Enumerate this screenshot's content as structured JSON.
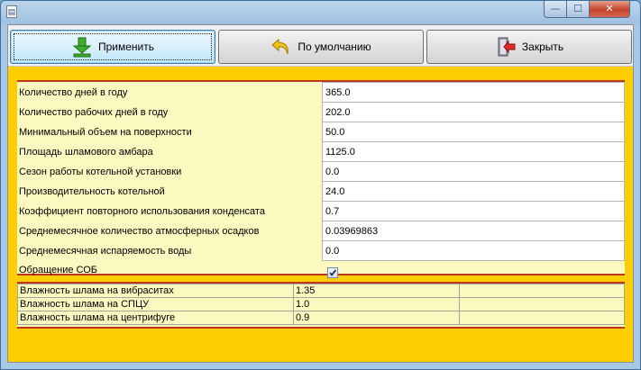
{
  "window": {
    "controls": {
      "minimize": "—",
      "maximize": "☐",
      "close": "✕"
    }
  },
  "toolbar": {
    "apply_label": "Применить",
    "defaults_label": "По умолчанию",
    "close_label": "Закрыть",
    "icons": {
      "apply": "download-arrow-icon",
      "defaults": "undo-arrow-icon",
      "close": "exit-door-icon"
    }
  },
  "parameters": [
    {
      "label": "Количество дней в году",
      "value": "365.0"
    },
    {
      "label": "Количество рабочих дней в году",
      "value": "202.0"
    },
    {
      "label": "Минимальный объем на поверхности",
      "value": "50.0"
    },
    {
      "label": "Площадь шламового амбара",
      "value": "1125.0"
    },
    {
      "label": "Сезон работы котельной установки",
      "value": "0.0"
    },
    {
      "label": "Производительность котельной",
      "value": "24.0"
    },
    {
      "label": "Коэффициент повторного  использования конденсата",
      "value": "0.7"
    },
    {
      "label": "Среднемесячное количество атмосферных осадков",
      "value": "0.03969863"
    },
    {
      "label": "Среднемесячная испаряемость воды",
      "value": "0.0"
    }
  ],
  "sob": {
    "label": "Обращение СОБ",
    "checked": true
  },
  "humidity": [
    {
      "label": "Влажность шлама на вибраситах",
      "value": "1.35",
      "extra": ""
    },
    {
      "label": "Влажность шлама на СПЦУ",
      "value": "1.0",
      "extra": ""
    },
    {
      "label": "Влажность шлама на центрифуге",
      "value": "0.9",
      "extra": ""
    }
  ],
  "colors": {
    "form_bg": "#ffce00",
    "panel_bg": "#fbf9bf",
    "accent_line": "#c0361b"
  }
}
